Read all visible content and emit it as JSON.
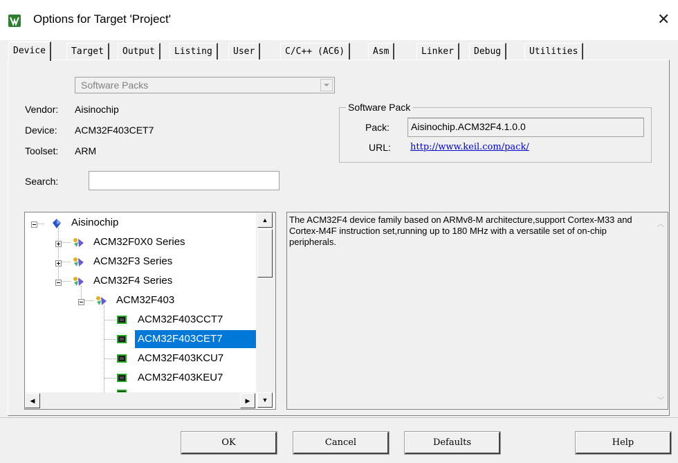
{
  "window": {
    "title": "Options for Target 'Project'",
    "close_glyph": "✕"
  },
  "tabs": [
    {
      "label": "Device",
      "active": true
    },
    {
      "label": "Target"
    },
    {
      "label": "Output"
    },
    {
      "label": "Listing"
    },
    {
      "label": "User"
    },
    {
      "label": "C/C++ (AC6)"
    },
    {
      "label": "Asm"
    },
    {
      "label": "Linker"
    },
    {
      "label": "Debug"
    },
    {
      "label": "Utilities"
    }
  ],
  "device": {
    "source_select": "Software Packs",
    "vendor_label": "Vendor:",
    "vendor_value": "Aisinochip",
    "device_label": "Device:",
    "device_value": "ACM32F403CET7",
    "toolset_label": "Toolset:",
    "toolset_value": "ARM",
    "search_label": "Search:",
    "search_value": ""
  },
  "software_pack": {
    "group_title": "Software Pack",
    "pack_label": "Pack:",
    "pack_value": "Aisinochip.ACM32F4.1.0.0",
    "url_label": "URL:",
    "url_value": "http://www.keil.com/pack/"
  },
  "tree": {
    "items": [
      {
        "label": "Aisinochip",
        "level": 0,
        "expanded": true,
        "icon": "vendor-diamond-icon"
      },
      {
        "label": "ACM32F0X0 Series",
        "level": 1,
        "expanded": false,
        "icon": "family-icon"
      },
      {
        "label": "ACM32F3 Series",
        "level": 1,
        "expanded": false,
        "icon": "family-icon"
      },
      {
        "label": "ACM32F4 Series",
        "level": 1,
        "expanded": true,
        "icon": "family-icon"
      },
      {
        "label": "ACM32F403",
        "level": 2,
        "expanded": true,
        "icon": "subfamily-icon"
      },
      {
        "label": "ACM32F403CCT7",
        "level": 3,
        "icon": "chip-icon"
      },
      {
        "label": "ACM32F403CET7",
        "level": 3,
        "icon": "chip-icon",
        "selected": true
      },
      {
        "label": "ACM32F403KCU7",
        "level": 3,
        "icon": "chip-icon"
      },
      {
        "label": "ACM32F403KEU7",
        "level": 3,
        "icon": "chip-icon"
      }
    ]
  },
  "description": "The ACM32F4 device family based on ARMv8-M architecture,support Cortex-M33 and Cortex-M4F instruction set,running up to 180 MHz with a versatile set of on-chip peripherals.",
  "buttons": {
    "ok": "OK",
    "cancel": "Cancel",
    "defaults": "Defaults",
    "help": "Help"
  },
  "colors": {
    "selection": "#0078d7",
    "link": "#0000c8",
    "dialog_bg": "#f0f0f0"
  }
}
